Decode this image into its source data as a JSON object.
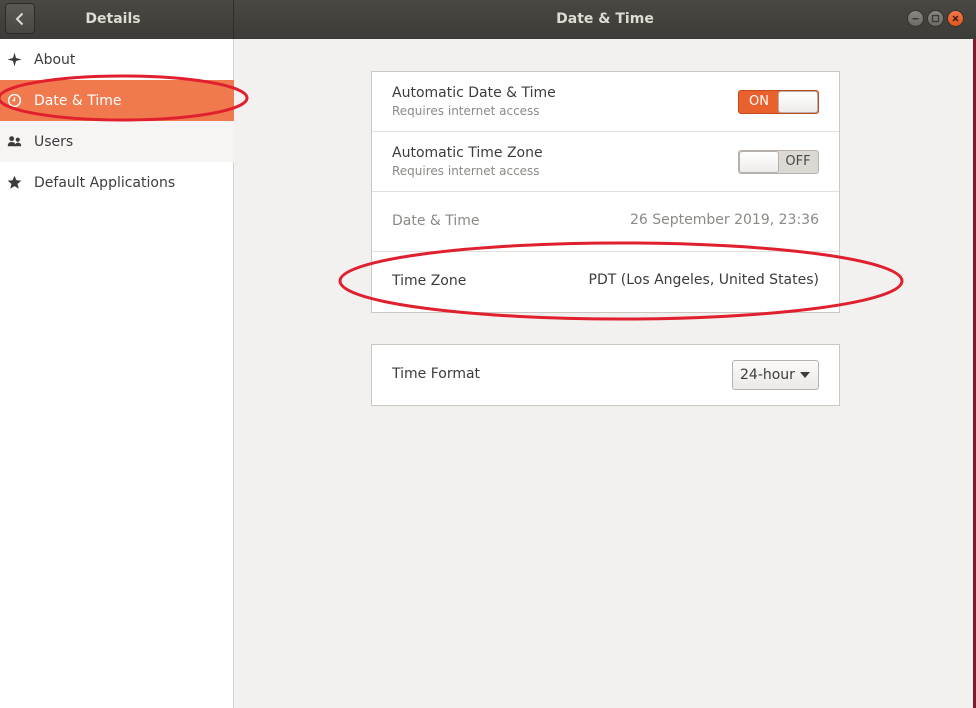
{
  "titlebar": {
    "sidebar_title": "Details",
    "window_title": "Date & Time"
  },
  "sidebar": {
    "items": [
      {
        "label": "About",
        "icon": "sparkle-icon"
      },
      {
        "label": "Date & Time",
        "icon": "clock-icon",
        "selected": true
      },
      {
        "label": "Users",
        "icon": "users-icon"
      },
      {
        "label": "Default Applications",
        "icon": "star-icon"
      }
    ]
  },
  "date_time_card": {
    "auto_date_time": {
      "label": "Automatic Date & Time",
      "sublabel": "Requires internet access",
      "switch_state": "ON"
    },
    "auto_time_zone": {
      "label": "Automatic Time Zone",
      "sublabel": "Requires internet access",
      "switch_state": "OFF"
    },
    "date_time": {
      "label": "Date & Time",
      "value": "26 September 2019, 23:36"
    },
    "time_zone": {
      "label": "Time Zone",
      "value": "PDT (Los Angeles, United States)"
    }
  },
  "format_card": {
    "label": "Time Format",
    "selected": "24-hour"
  },
  "colors": {
    "accent": "#e9622e",
    "selected_row": "#f0794d",
    "annotation": "#e0202e"
  }
}
